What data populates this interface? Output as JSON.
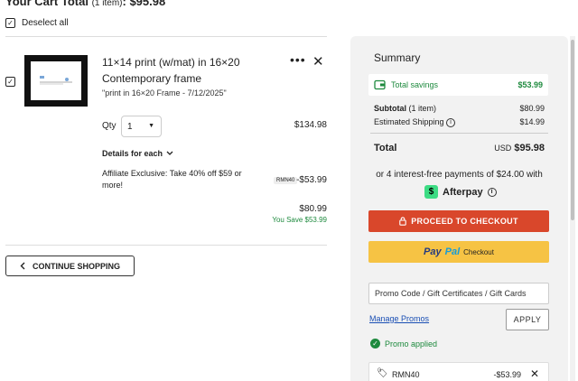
{
  "cart": {
    "title": "Your Cart Total",
    "count_label": "(1 item)",
    "total": ": $95.98",
    "deselect_label": "Deselect all"
  },
  "item": {
    "title": "11×14 print (w/mat) in 16×20",
    "subtitle": "Contemporary frame",
    "description": "\"print in 16×20 Frame - 7/12/2025\"",
    "more_icon": "more-horizontal-icon",
    "close_icon": "close-icon",
    "qty_label": "Qty",
    "qty_value": "1",
    "line_price": "$134.98",
    "details_label": "Details for each",
    "promo_note": "Affiliate Exclusive: Take 40% off $59 or more!",
    "promo_tag": "RMN40",
    "promo_amount": "-$53.99",
    "final_price": "$80.99",
    "you_save": "You Save $53.99"
  },
  "continue_label": "CONTINUE SHOPPING",
  "summary": {
    "title": "Summary",
    "savings_label": "Total savings",
    "savings_value": "$53.99",
    "subtotal_label": "Subtotal",
    "subtotal_count": "(1 item)",
    "subtotal_value": "$80.99",
    "shipping_label": "Estimated Shipping",
    "shipping_value": "$14.99",
    "total_label": "Total",
    "total_currency": "USD",
    "total_value": "$95.98",
    "installments_text": "or 4 interest-free payments of $24.00 with",
    "afterpay_label": "Afterpay",
    "checkout_label": "PROCEED TO CHECKOUT",
    "paypal_brand_1": "Pay",
    "paypal_brand_2": "Pal",
    "paypal_checkout": "Checkout",
    "promo_placeholder": "Promo Code / Gift Certificates / Gift Cards",
    "manage_promos": "Manage Promos",
    "apply_label": "APPLY",
    "promo_applied": "Promo applied",
    "applied_code": "RMN40",
    "applied_amount": "-$53.99"
  },
  "colors": {
    "checkout": "#d9472b",
    "paypal": "#f6c344",
    "savings_green": "#1e8a3e",
    "link_blue": "#1a4fb4"
  }
}
